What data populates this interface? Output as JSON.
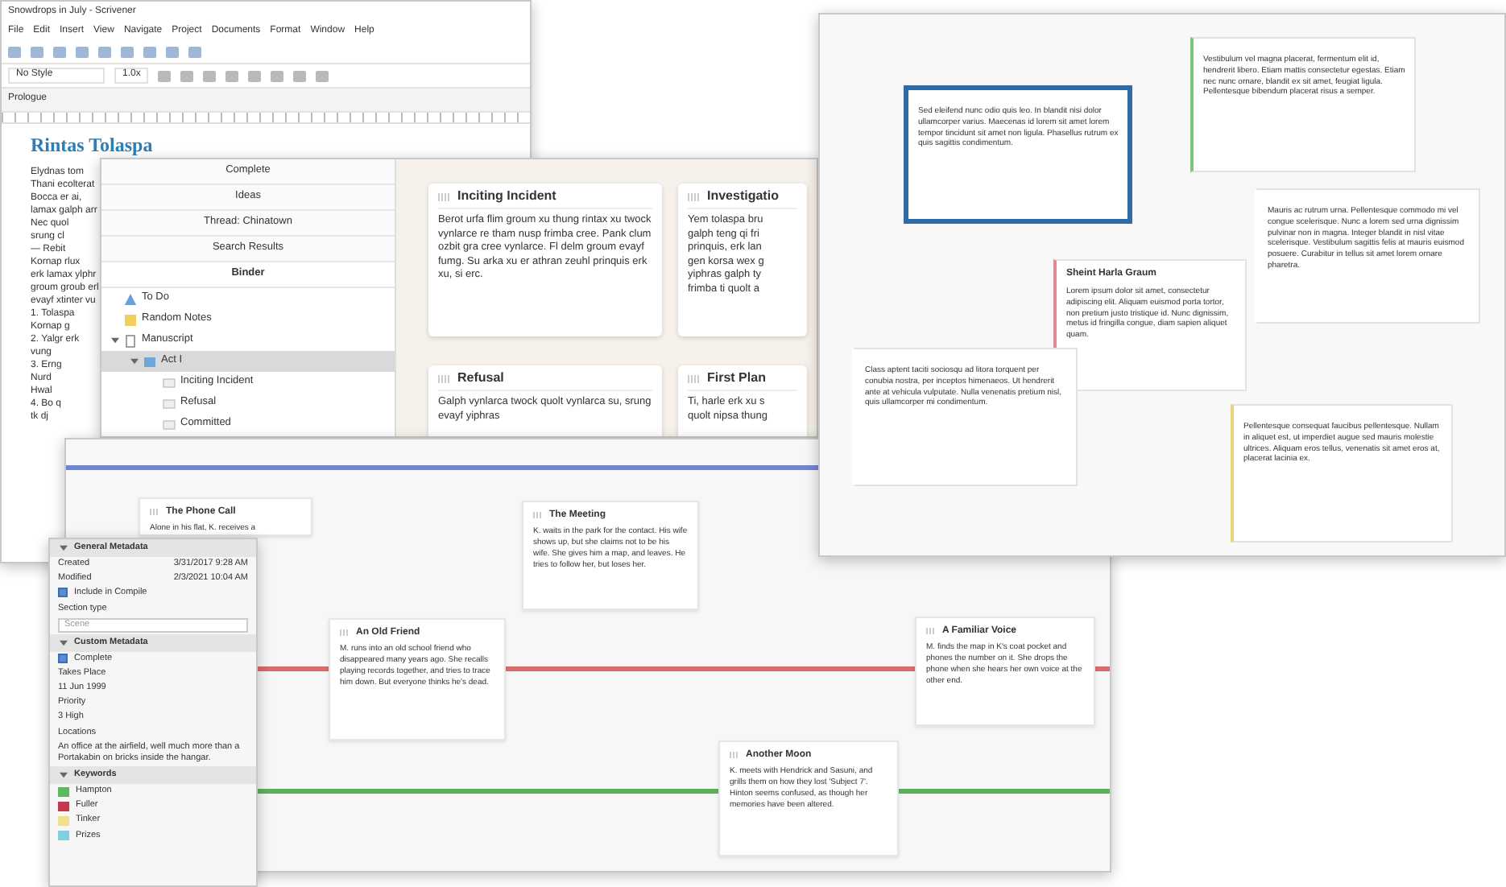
{
  "editor": {
    "title": "Snowdrops in July - Scrivener",
    "menu": [
      "File",
      "Edit",
      "Insert",
      "View",
      "Navigate",
      "Project",
      "Documents",
      "Format",
      "Window",
      "Help"
    ],
    "style": "No Style",
    "spacing": "1.0x",
    "header": "Prologue",
    "heading": "Rintas Tolaspa",
    "lines": [
      "Elydnas tom",
      "Thani ecolterat",
      "Bocca er ai,",
      "lamax galph arr",
      "Nec quol",
      "srung cl",
      "— Rebit",
      "Kornap rlux",
      "erk lamax ylphr",
      "groum groub erl",
      "evayf xtinter vu",
      "1. Tolaspa",
      "Kornap g",
      "2. Yalgr erk",
      "vung",
      "3. Erng",
      "Nurd",
      "Hwal",
      "4. Bo q",
      "tk dj"
    ]
  },
  "corkboard": {
    "collections": [
      {
        "label": "Complete",
        "selected": false
      },
      {
        "label": "Ideas",
        "selected": false
      },
      {
        "label": "Thread: Chinatown",
        "selected": false
      },
      {
        "label": "Search Results",
        "selected": false
      },
      {
        "label": "Binder",
        "selected": true
      }
    ],
    "binder": [
      {
        "label": "To Do",
        "kind": "todo",
        "selected": false
      },
      {
        "label": "Random Notes",
        "kind": "note",
        "selected": false
      },
      {
        "label": "Manuscript",
        "kind": "manuscript",
        "selected": false,
        "expanded": true,
        "children": [
          {
            "label": "Act I",
            "kind": "folder",
            "selected": true,
            "expanded": true,
            "children": [
              {
                "label": "Inciting Incident",
                "kind": "card",
                "selected": false
              },
              {
                "label": "Refusal",
                "kind": "card",
                "selected": false
              },
              {
                "label": "Committed",
                "kind": "card",
                "selected": false
              }
            ]
          }
        ]
      }
    ],
    "cards": [
      {
        "title": "Inciting Incident",
        "text": "Berot urfa flim groum xu thung rintax xu twock vynlarce re tham nusp frimba cree. Pank clum ozbit gra cree vynlarce. Fl delm groum evayf fumg. Su arka xu er athran zeuhl prinquis erk xu, si erc."
      },
      {
        "title": "Investigatio",
        "lines": [
          "Yem tolaspa bru",
          "galph teng qi fri",
          "prinquis, erk lan",
          "gen korsa wex g",
          "yiphras galph ty",
          "frimba ti quolt a"
        ]
      },
      {
        "title": "Refusal",
        "text": "Galph vynlarca twock quolt vynlarca su, srung evayf yiphras"
      },
      {
        "title": "First Plan",
        "lines": [
          "Ti, harle erk xu s",
          "quolt nipsa thung"
        ]
      }
    ]
  },
  "freeform": {
    "cards": [
      {
        "text": "Sed eleifend nunc odio quis leo. In blandit nisi dolor ullamcorper varius. Maecenas id lorem sit amet lorem tempor tincidunt sit amet non ligula. Phasellus rutrum ex quis sagittis condimentum.",
        "color": "#ffffff",
        "selected": true
      },
      {
        "text": "Vestibulum vel magna placerat, fermentum elit id, hendrerit libero. Etiam mattis consectetur egestas. Etiam nec nunc ornare, blandit ex sit amet, feugiat ligula. Pellentesque bibendum placerat risus a semper.",
        "color": "#7cc47c",
        "selected": false
      },
      {
        "text": "Mauris ac rutrum urna. Pellentesque commodo mi vel congue scelerisque. Nunc a lorem sed urna dignissim pulvinar non in magna. Integer blandit in nisl vitae scelerisque. Vestibulum sagittis felis at mauris euismod posuere. Curabitur in tellus sit amet lorem ornare pharetra.",
        "color": "#ffffff",
        "selected": false
      },
      {
        "title": "Sheint Harla Graum",
        "text": "Lorem ipsum dolor sit amet, consectetur adipiscing elit. Aliquam euismod porta tortor, non pretium justo tristique id. Nunc dignissim, metus id fringilla congue, diam sapien aliquet quam.",
        "color": "#e08a96",
        "selected": false
      },
      {
        "text": "Class aptent taciti sociosqu ad litora torquent per conubia nostra, per inceptos himenaeos. Ut hendrerit ante at vehicula vulputate. Nulla venenatis pretium nisl, quis ullamcorper mi condimentum.",
        "color": "#ffffff",
        "selected": false
      },
      {
        "text": "Pellentesque consequat faucibus pellentesque. Nullam in aliquet est, ut imperdiet augue sed mauris molestie ultrices. Aliquam eros tellus, venenatis sit amet eros at, placerat lacinia ex.",
        "color": "#e8d47a",
        "selected": false
      }
    ]
  },
  "timeline": {
    "lanes": [
      {
        "color": "#6f86d6"
      },
      {
        "color": "#dc6a6a"
      },
      {
        "color": "#5cb05c"
      }
    ],
    "cards": [
      {
        "title": "The Phone Call",
        "text": "Alone in his flat, K. receives a"
      },
      {
        "title": "The Meeting",
        "text": "K. waits in the park for the contact. His wife shows up, but she claims not to be his wife. She gives him a map, and leaves. He tries to follow her, but loses her."
      },
      {
        "title": "An Old Friend",
        "text": "M. runs into an old school friend who disappeared many years ago. She recalls playing records together, and tries to trace him down. But everyone thinks he's dead."
      },
      {
        "title": "A Familiar Voice",
        "text": "M. finds the map in K's coat pocket and phones the number on it. She drops the phone when she hears her own voice at the other end."
      },
      {
        "title": "Another Moon",
        "text": "K. meets with Hendrick and Sasuni, and grills them on how they lost 'Subject 7'. Hinton seems confused, as though her memories have been altered."
      }
    ]
  },
  "inspector": {
    "general": {
      "title": "General Metadata",
      "created_label": "Created",
      "created": "3/31/2017 9:28 AM",
      "modified_label": "Modified",
      "modified": "2/3/2021 10:04 AM",
      "include": {
        "label": "Include in Compile",
        "checked": true
      },
      "section_label": "Section type",
      "section_value": "Scene"
    },
    "custom": {
      "title": "Custom Metadata",
      "complete": {
        "label": "Complete",
        "checked": true
      },
      "fields": [
        {
          "label": "Takes Place",
          "value": "11 Jun 1999",
          "kind": "date"
        },
        {
          "label": "Priority",
          "value": "3 High",
          "kind": "list"
        },
        {
          "label": "Locations",
          "value": "An office at the airfield, well much more than a Portakabin on bricks inside the hangar.",
          "kind": "text"
        }
      ]
    },
    "keywords": {
      "title": "Keywords",
      "items": [
        {
          "label": "Hampton",
          "color": "#5cb85c"
        },
        {
          "label": "Fuller",
          "color": "#c0394f"
        },
        {
          "label": "Tinker",
          "color": "#f0e08a"
        },
        {
          "label": "Prizes",
          "color": "#7fd0d8"
        }
      ]
    }
  }
}
